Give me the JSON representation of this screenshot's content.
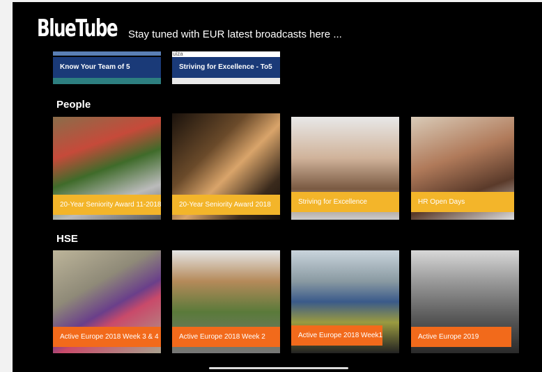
{
  "header": {
    "logo": "BlueTube",
    "tagline": "Stay tuned with EUR latest broadcasts here ..."
  },
  "top_row": [
    {
      "title": "Know Your Team of 5"
    },
    {
      "title": "Striving for Excellence - To5",
      "label_fragment": "uiza"
    }
  ],
  "sections": [
    {
      "title": "People",
      "tiles": [
        {
          "title": "20-Year Seniority Award 11-2018",
          "caption_color": "#f3b52a"
        },
        {
          "title": "20-Year Seniority Award 2018",
          "caption_color": "#f3b52a"
        },
        {
          "title": "Striving for Excellence",
          "caption_color": "#f3b52a"
        },
        {
          "title": "HR Open Days",
          "caption_color": "#f3b52a"
        }
      ]
    },
    {
      "title": "HSE",
      "tiles": [
        {
          "title": "Active Europe 2018 Week 3 & 4",
          "caption_color": "#f26a1b"
        },
        {
          "title": "Active Europe 2018 Week 2",
          "caption_color": "#f26a1b"
        },
        {
          "title": "Active Europe 2018 Week1",
          "caption_color": "#f26a1b"
        },
        {
          "title": "Active Europe 2019",
          "caption_color": "#f26a1b"
        }
      ]
    }
  ]
}
